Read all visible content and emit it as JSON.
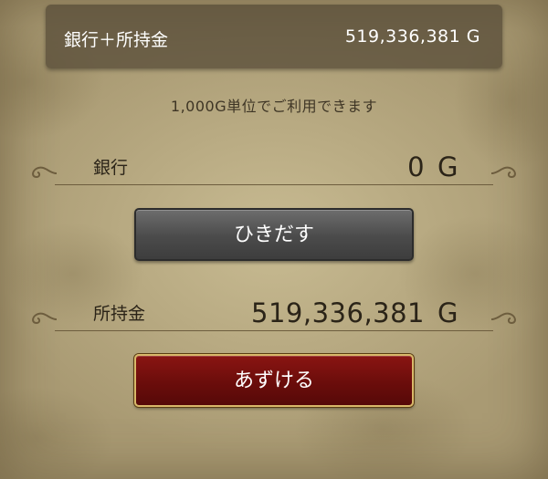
{
  "summary": {
    "label": "銀行＋所持金",
    "value": "519,336,381",
    "unit": "G"
  },
  "notice": "1,000G単位でご利用できます",
  "bank": {
    "label": "銀行",
    "value": "0",
    "unit": "G"
  },
  "withdraw_button": {
    "label": "ひきだす"
  },
  "wallet": {
    "label": "所持金",
    "value": "519,336,381",
    "unit": "G"
  },
  "deposit_button": {
    "label": "あずける"
  },
  "colors": {
    "background": "#b3a47d",
    "deposit": "#6b0d0b",
    "withdraw": "#4b4b4b",
    "gold_border": "#d9b86a"
  }
}
